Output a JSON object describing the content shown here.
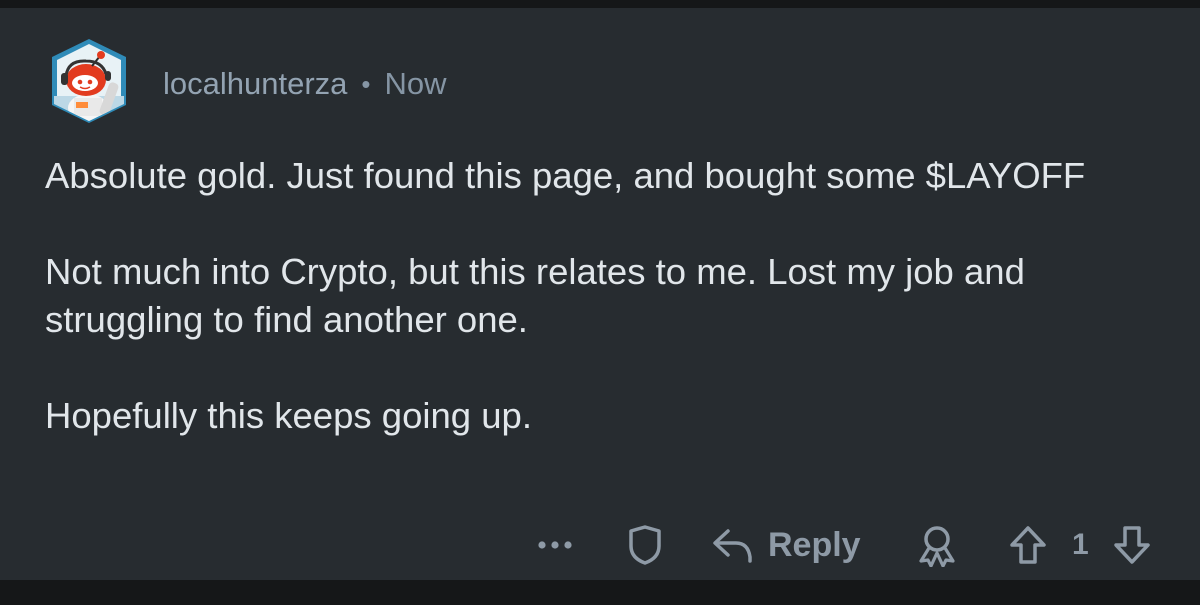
{
  "comment": {
    "author": "localhunterza",
    "separator": "•",
    "timestamp": "Now",
    "avatar_icon": "snoo-avatar-icon",
    "paragraphs": [
      "Absolute gold. Just found this page, and bought some $LAYOFF",
      "Not much into Crypto, but this relates to me. Lost my job and struggling to find another one.",
      "Hopefully this keeps going up."
    ]
  },
  "actions": {
    "more_icon": "more-dots-icon",
    "mod_icon": "shield-icon",
    "reply_icon": "reply-arrow-icon",
    "reply_label": "Reply",
    "award_icon": "award-icon",
    "upvote_icon": "upvote-arrow-icon",
    "vote_count": "1",
    "downvote_icon": "downvote-arrow-icon"
  },
  "colors": {
    "card_background": "#272c30",
    "page_background": "#151718",
    "body_text": "#e1e6ea",
    "meta_text": "#8595a4",
    "action_icons": "#8e9aa6"
  }
}
